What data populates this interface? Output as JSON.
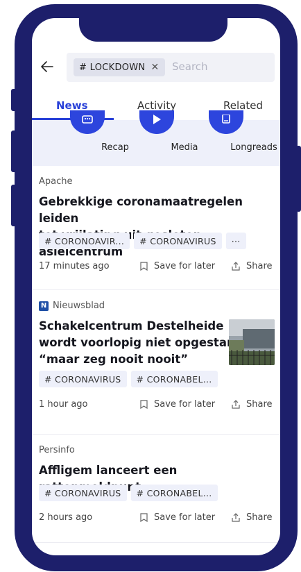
{
  "search": {
    "chip_label": "# LOCKDOWN",
    "chip_remove": "✕",
    "placeholder": "Search"
  },
  "tabs": [
    {
      "label": "News",
      "active": true
    },
    {
      "label": "Activity",
      "active": false
    },
    {
      "label": "Related",
      "active": false
    }
  ],
  "quicklinks": [
    {
      "label": "Recap",
      "icon": "recap-icon"
    },
    {
      "label": "Media",
      "icon": "play-icon"
    },
    {
      "label": "Longreads",
      "icon": "document-icon"
    }
  ],
  "articles": [
    {
      "source": "Apache",
      "title_lines": [
        "Gebrekkige coronamaatregelen leiden",
        "tot vrijlating uit gesloten asielcentrum"
      ],
      "tags": [
        "# CORONOAVIR...",
        "# CORONAVIRUS",
        "···"
      ],
      "time": "17 minutes ago",
      "save": "Save for later",
      "share": "Share"
    },
    {
      "source": "Nieuwsblad",
      "source_logo": "N",
      "title_lines": [
        "Schakelcentrum Destelheide",
        "wordt voorlopig niet opgestart,",
        "“maar zeg nooit nooit”"
      ],
      "tags": [
        "# CORONAVIRUS",
        "# CORONABEL..."
      ],
      "time": "1 hour ago",
      "save": "Save for later",
      "share": "Share"
    },
    {
      "source": "Persinfo",
      "title_lines": [
        "Affligem lanceert een rattenmeldpunt"
      ],
      "tags": [
        "# CORONAVIRUS",
        "# CORONABEL..."
      ],
      "time": "2 hours ago",
      "save": "Save for later",
      "share": "Share"
    }
  ],
  "colors": {
    "frame": "#1d1f6b",
    "accent": "#2840d8",
    "strip": "#eef0fa"
  }
}
